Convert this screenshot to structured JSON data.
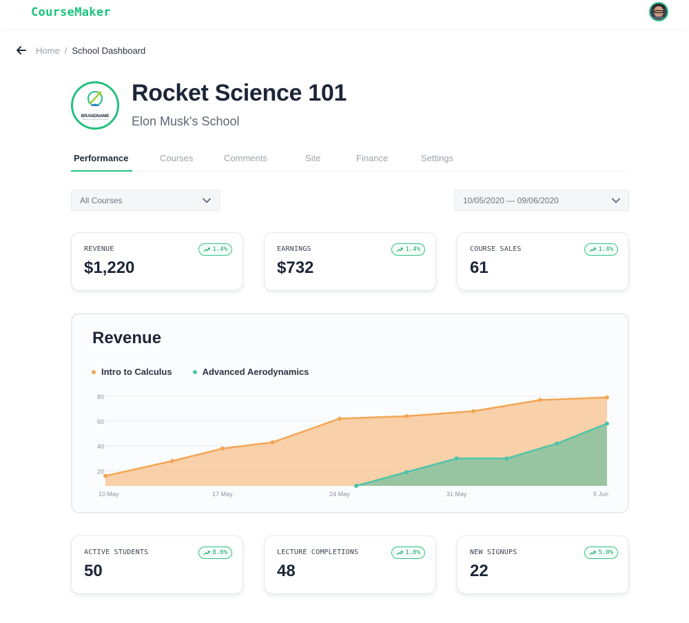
{
  "app": {
    "brand": "CourseMaker"
  },
  "breadcrumb": {
    "home": "Home",
    "separator": "/",
    "current": "School Dashboard"
  },
  "course": {
    "title": "Rocket Science 101",
    "school": "Elon Musk's School",
    "logo_text": "BRANDNAME"
  },
  "tabs": [
    {
      "label": "Performance",
      "active": true
    },
    {
      "label": "Courses",
      "active": false
    },
    {
      "label": "Comments",
      "active": false
    },
    {
      "label": "Site",
      "active": false
    },
    {
      "label": "Finance",
      "active": false
    },
    {
      "label": "Settings",
      "active": false
    }
  ],
  "filters": {
    "course_select": "All Courses",
    "date_range": "10/05/2020 — 09/06/2020"
  },
  "stats_top": [
    {
      "label": "REVENUE",
      "value": "$1,220",
      "change": "1.4%"
    },
    {
      "label": "EARNINGS",
      "value": "$732",
      "change": "1.4%"
    },
    {
      "label": "COURSE SALES",
      "value": "61",
      "change": "1.4%"
    }
  ],
  "stats_bottom": [
    {
      "label": "ACTIVE STUDENTS",
      "value": "50",
      "change": "8.0%"
    },
    {
      "label": "LECTURE COMPLETIONS",
      "value": "48",
      "change": "1.0%"
    },
    {
      "label": "NEW SIGNUPS",
      "value": "22",
      "change": "5.0%"
    }
  ],
  "colors": {
    "accent": "#19c37d",
    "series_calculus": "#f2a654",
    "series_aero": "#4fc3a8"
  },
  "chart_data": {
    "type": "area",
    "title": "Revenue",
    "x": [
      "2020-05-10",
      "2020-05-13",
      "2020-05-16",
      "2020-05-19",
      "2020-05-22",
      "2020-05-25",
      "2020-05-28",
      "2020-05-31",
      "2020-06-03",
      "2020-06-06",
      "2020-06-09"
    ],
    "x_tick_labels": [
      "10 May",
      "17 May",
      "24 May",
      "31 May",
      "9 Jun"
    ],
    "y_tick_labels": [
      "20",
      "40",
      "60",
      "80"
    ],
    "ylim": [
      8,
      80
    ],
    "series": [
      {
        "name": "Intro to Calculus",
        "color": "#f2a654",
        "values": [
          null,
          16,
          28,
          38,
          43,
          62,
          64,
          68,
          77,
          79,
          null
        ],
        "x": [
          "2020-05-10",
          "2020-05-10",
          "2020-05-14",
          "2020-05-17",
          "2020-05-20",
          "2020-05-24",
          "2020-05-28",
          "2020-06-01",
          "2020-06-05",
          "2020-06-09",
          "2020-06-09"
        ]
      },
      {
        "name": "Advanced Aerodynamics",
        "color": "#4fc3a8",
        "values": [
          8,
          19,
          30,
          30,
          42,
          58
        ]
      }
    ],
    "series_points": {
      "Intro to Calculus": [
        [
          "2020-05-10",
          16
        ],
        [
          "2020-05-14",
          28
        ],
        [
          "2020-05-17",
          38
        ],
        [
          "2020-05-20",
          43
        ],
        [
          "2020-05-24",
          62
        ],
        [
          "2020-05-28",
          64
        ],
        [
          "2020-06-01",
          68
        ],
        [
          "2020-06-05",
          77
        ],
        [
          "2020-06-09",
          79
        ]
      ],
      "Advanced Aerodynamics": [
        [
          "2020-05-25",
          8
        ],
        [
          "2020-05-28",
          19
        ],
        [
          "2020-05-31",
          30
        ],
        [
          "2020-06-03",
          30
        ],
        [
          "2020-06-06",
          42
        ],
        [
          "2020-06-09",
          58
        ]
      ]
    },
    "legend": "top-left",
    "grid": true
  }
}
